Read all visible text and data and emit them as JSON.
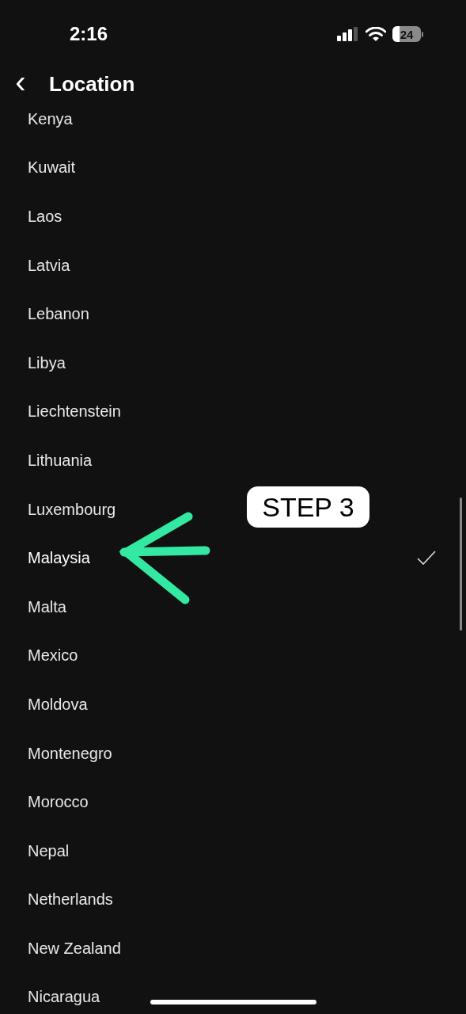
{
  "status_bar": {
    "time": "2:16",
    "battery": "24"
  },
  "header": {
    "back": "‹",
    "title": "Location"
  },
  "countries": [
    {
      "name": "Kenya",
      "selected": false
    },
    {
      "name": "Kuwait",
      "selected": false
    },
    {
      "name": "Laos",
      "selected": false
    },
    {
      "name": "Latvia",
      "selected": false
    },
    {
      "name": "Lebanon",
      "selected": false
    },
    {
      "name": "Libya",
      "selected": false
    },
    {
      "name": "Liechtenstein",
      "selected": false
    },
    {
      "name": "Lithuania",
      "selected": false
    },
    {
      "name": "Luxembourg",
      "selected": false
    },
    {
      "name": "Malaysia",
      "selected": true
    },
    {
      "name": "Malta",
      "selected": false
    },
    {
      "name": "Mexico",
      "selected": false
    },
    {
      "name": "Moldova",
      "selected": false
    },
    {
      "name": "Montenegro",
      "selected": false
    },
    {
      "name": "Morocco",
      "selected": false
    },
    {
      "name": "Nepal",
      "selected": false
    },
    {
      "name": "Netherlands",
      "selected": false
    },
    {
      "name": "New Zealand",
      "selected": false
    },
    {
      "name": "Nicaragua",
      "selected": false
    }
  ],
  "annotation": {
    "label": "STEP 3"
  }
}
